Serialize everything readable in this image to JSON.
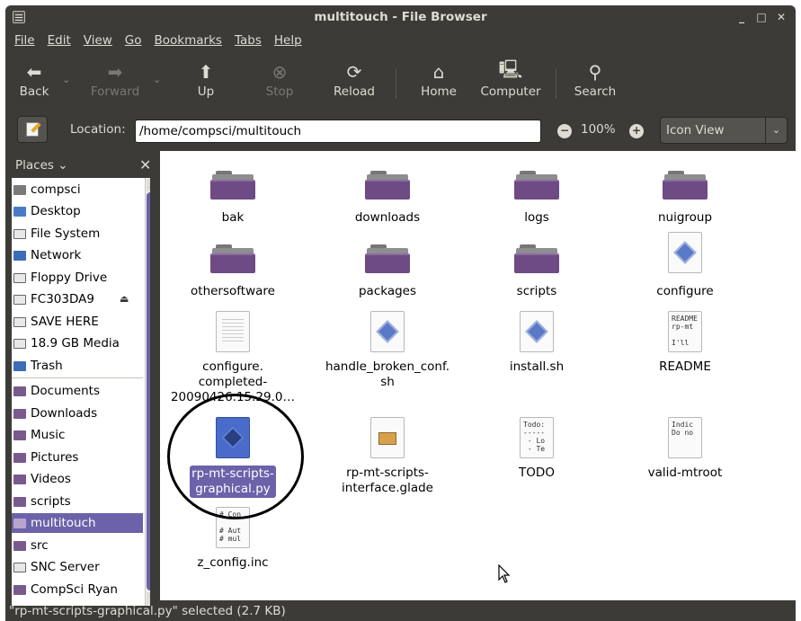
{
  "window": {
    "title": "multitouch - File Browser"
  },
  "menubar": [
    "File",
    "Edit",
    "View",
    "Go",
    "Bookmarks",
    "Tabs",
    "Help"
  ],
  "toolbar": {
    "back": "Back",
    "forward": "Forward",
    "up": "Up",
    "stop": "Stop",
    "reload": "Reload",
    "home": "Home",
    "computer": "Computer",
    "search": "Search"
  },
  "location": {
    "label": "Location:",
    "path": "/home/compsci/multitouch",
    "zoom": "100%",
    "view": "Icon View"
  },
  "sidebar": {
    "header": "Places",
    "items": [
      {
        "label": "compsci",
        "icon": "home-folder-icon"
      },
      {
        "label": "Desktop",
        "icon": "desktop-icon"
      },
      {
        "label": "File System",
        "icon": "drive-icon"
      },
      {
        "label": "Network",
        "icon": "network-icon"
      },
      {
        "label": "Floppy Drive",
        "icon": "floppy-icon"
      },
      {
        "label": "FC303DA9",
        "icon": "drive-icon"
      },
      {
        "label": "SAVE HERE",
        "icon": "drive-icon"
      },
      {
        "label": "18.9 GB Media",
        "icon": "drive-icon"
      },
      {
        "label": "Trash",
        "icon": "trash-icon"
      },
      {
        "label": "Documents",
        "icon": "folder-icon"
      },
      {
        "label": "Downloads",
        "icon": "folder-icon"
      },
      {
        "label": "Music",
        "icon": "folder-icon"
      },
      {
        "label": "Pictures",
        "icon": "folder-icon"
      },
      {
        "label": "Videos",
        "icon": "folder-icon"
      },
      {
        "label": "scripts",
        "icon": "folder-icon"
      },
      {
        "label": "multitouch",
        "icon": "folder-icon"
      },
      {
        "label": "src",
        "icon": "folder-icon"
      },
      {
        "label": "SNC Server",
        "icon": "drive-icon"
      },
      {
        "label": "CompSci Ryan",
        "icon": "folder-icon"
      }
    ],
    "selected": "multitouch"
  },
  "files": [
    {
      "name": "bak",
      "type": "folder"
    },
    {
      "name": "downloads",
      "type": "folder"
    },
    {
      "name": "logs",
      "type": "folder"
    },
    {
      "name": "nuigroup",
      "type": "folder"
    },
    {
      "name": "othersoftware",
      "type": "folder"
    },
    {
      "name": "packages",
      "type": "folder"
    },
    {
      "name": "scripts",
      "type": "folder"
    },
    {
      "name": "configure",
      "type": "script"
    },
    {
      "name_lines": [
        "configure.",
        "completed-",
        "20090426.15.29.0…"
      ],
      "type": "text"
    },
    {
      "name_lines": [
        "handle_broken_conf.",
        "sh"
      ],
      "type": "script"
    },
    {
      "name": "install.sh",
      "type": "script"
    },
    {
      "name": "README",
      "type": "text",
      "preview": "README\nrp-mt\n\nI'll"
    },
    {
      "name_lines": [
        "rp-mt-scripts-",
        "graphical.py"
      ],
      "type": "script",
      "selected": true
    },
    {
      "name_lines": [
        "rp-mt-scripts-",
        "interface.glade"
      ],
      "type": "glade"
    },
    {
      "name": "TODO",
      "type": "text",
      "preview": "Todo:\n-----\n - Lo\n - Te"
    },
    {
      "name": "valid-mtroot",
      "type": "text",
      "preview": "Indic\nDo no"
    },
    {
      "name": "z_config.inc",
      "type": "text",
      "preview": "# Con\n\n# Aut\n# mul"
    }
  ],
  "statusbar": {
    "text": "\"rp-mt-scripts-graphical.py\" selected (2.7 KB)"
  }
}
